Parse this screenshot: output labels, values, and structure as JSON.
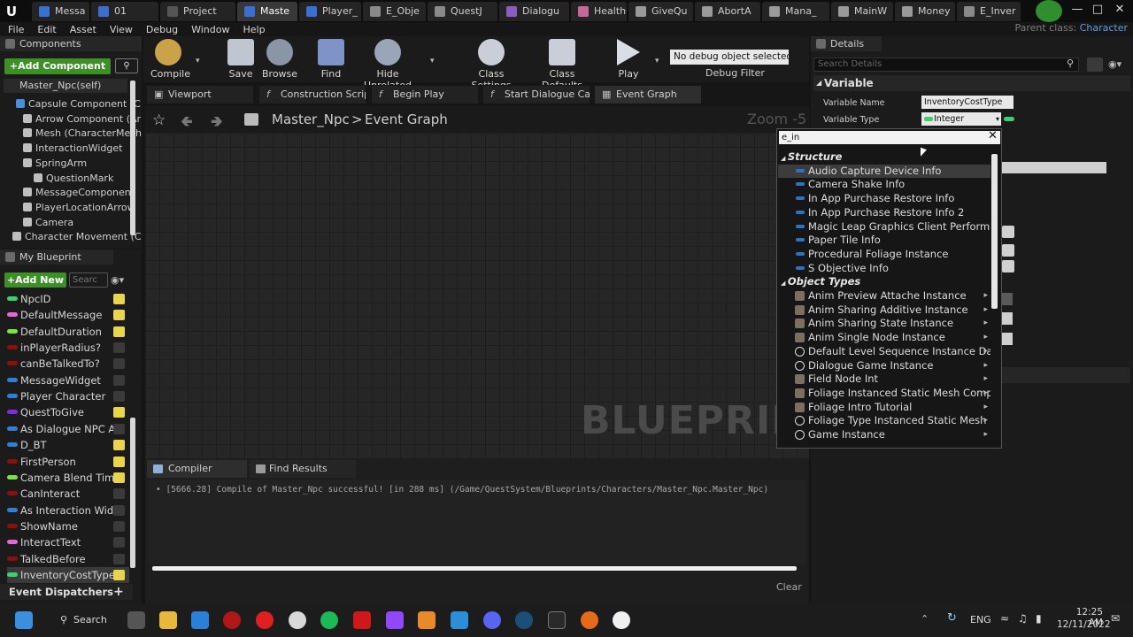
{
  "window_tabs": [
    {
      "label": "Messa",
      "color": "#3b6fd1"
    },
    {
      "label": "01",
      "color": "#3b6fd1"
    },
    {
      "label": "Project",
      "color": "#555555"
    },
    {
      "label": "Maste",
      "color": "#3b6fd1"
    },
    {
      "label": "Player_",
      "color": "#3b6fd1"
    },
    {
      "label": "E_Obje",
      "color": "#8a8a8a"
    },
    {
      "label": "QuestJ",
      "color": "#8a8a8a"
    },
    {
      "label": "Dialogu",
      "color": "#8a5cc4"
    },
    {
      "label": "HealthC",
      "color": "#c46a9a"
    },
    {
      "label": "GiveQu",
      "color": "#9a9a9a"
    },
    {
      "label": "AbortA",
      "color": "#9a9a9a"
    },
    {
      "label": "Mana_",
      "color": "#9a9a9a"
    },
    {
      "label": "MainW",
      "color": "#9a9a9a"
    },
    {
      "label": "Money",
      "color": "#9a9a9a"
    },
    {
      "label": "E_Inver",
      "color": "#8a8a8a"
    }
  ],
  "menu": [
    "File",
    "Edit",
    "Asset",
    "View",
    "Debug",
    "Window",
    "Help"
  ],
  "parent_class_label": "Parent class:",
  "parent_class_value": "Character",
  "components": {
    "title": "Components",
    "add_button": "+Add Component",
    "root": "Master_Npc(self)",
    "items": [
      {
        "label": "Capsule Component (C",
        "indent": 0,
        "color": "#4a8fd8"
      },
      {
        "label": "Arrow Component (Ar",
        "indent": 1,
        "color": "#bfbfbf"
      },
      {
        "label": "Mesh (CharacterMesh",
        "indent": 1,
        "color": "#bfbfbf"
      },
      {
        "label": "InteractionWidget",
        "indent": 1,
        "color": "#bfbfbf"
      },
      {
        "label": "SpringArm",
        "indent": 1,
        "color": "#bfbfbf"
      },
      {
        "label": "QuestionMark",
        "indent": 2,
        "color": "#bfbfbf"
      },
      {
        "label": "MessageComponent",
        "indent": 1,
        "color": "#bfbfbf"
      },
      {
        "label": "PlayerLocationArrow",
        "indent": 1,
        "color": "#bfbfbf"
      },
      {
        "label": "Camera",
        "indent": 1,
        "color": "#bfbfbf"
      },
      {
        "label": "Character Movement (C",
        "indent": 0,
        "color": "#bfbfbf"
      }
    ]
  },
  "my_blueprint": {
    "title": "My Blueprint",
    "add_button": "+Add New",
    "search_placeholder": "Searc",
    "variables": [
      {
        "name": "NpcID",
        "color": "#3fcf6f",
        "eye": true
      },
      {
        "name": "DefaultMessage",
        "color": "#e06ad8",
        "eye": true
      },
      {
        "name": "DefaultDuration",
        "color": "#7de04a",
        "eye": true
      },
      {
        "name": "inPlayerRadius?",
        "color": "#8a0f0f",
        "eye": false
      },
      {
        "name": "canBeTalkedTo?",
        "color": "#8a0f0f",
        "eye": false
      },
      {
        "name": "MessageWidget",
        "color": "#2f7fd8",
        "eye": false
      },
      {
        "name": "Player Character",
        "color": "#2f7fd8",
        "eye": false
      },
      {
        "name": "QuestToGive",
        "color": "#7b2fd8",
        "eye": true
      },
      {
        "name": "As Dialogue NPC A",
        "color": "#2f7fd8",
        "eye": false
      },
      {
        "name": "D_BT",
        "color": "#2f7fd8",
        "eye": true
      },
      {
        "name": "FirstPerson",
        "color": "#8a0f0f",
        "eye": true
      },
      {
        "name": "Camera Blend Time",
        "color": "#7de04a",
        "eye": true
      },
      {
        "name": "CanInteract",
        "color": "#8a0f0f",
        "eye": false
      },
      {
        "name": "As Interaction Wid",
        "color": "#2f7fd8",
        "eye": false
      },
      {
        "name": "ShowName",
        "color": "#8a0f0f",
        "eye": false
      },
      {
        "name": "InteractText",
        "color": "#e06ad8",
        "eye": false
      },
      {
        "name": "TalkedBefore",
        "color": "#8a0f0f",
        "eye": false
      },
      {
        "name": "InventoryCostType",
        "color": "#3fcf6f",
        "eye": true
      }
    ],
    "event_dispatchers": "Event Dispatchers"
  },
  "toolbar": {
    "buttons": [
      "Compile",
      "Save",
      "Browse",
      "Find",
      "Hide Unrelated",
      "Class Settings",
      "Class Defaults",
      "Play"
    ],
    "debug_select": "No debug object selected",
    "debug_filter": "Debug Filter"
  },
  "editor_tabs": [
    "Viewport",
    "Construction Scrip",
    "Begin Play",
    "Start Dialogue Car",
    "Event Graph"
  ],
  "graph": {
    "breadcrumb_root": "Master_Npc",
    "breadcrumb_sep": ">",
    "breadcrumb_leaf": "Event Graph",
    "zoom": "Zoom -5",
    "watermark": "BLUEPRIN"
  },
  "search_popup": {
    "query": "e_in",
    "category_structure": "Structure",
    "structure_items": [
      "Audio Capture Device Info",
      "Camera Shake Info",
      "In App Purchase Restore Info",
      "In App Purchase Restore Info 2",
      "Magic Leap Graphics Client Performan",
      "Paper Tile Info",
      "Procedural Foliage Instance",
      "S Objective Info"
    ],
    "category_object": "Object Types",
    "object_items": [
      {
        "label": "Anim Preview Attache Instance",
        "icon": "box",
        "arrow": true
      },
      {
        "label": "Anim Sharing Additive Instance",
        "icon": "box",
        "arrow": true
      },
      {
        "label": "Anim Sharing State Instance",
        "icon": "box",
        "arrow": true
      },
      {
        "label": "Anim Single Node Instance",
        "icon": "box",
        "arrow": true
      },
      {
        "label": "Default Level Sequence Instance Data",
        "icon": "circle",
        "arrow": true
      },
      {
        "label": "Dialogue Game Instance",
        "icon": "circle",
        "arrow": true
      },
      {
        "label": "Field Node Int",
        "icon": "box",
        "arrow": true
      },
      {
        "label": "Foliage Instanced Static Mesh Compor",
        "icon": "box",
        "arrow": true
      },
      {
        "label": "Foliage Intro Tutorial",
        "icon": "box",
        "arrow": true
      },
      {
        "label": "Foliage Type Instanced Static Mesh",
        "icon": "circle",
        "arrow": true
      },
      {
        "label": "Game Instance",
        "icon": "circle",
        "arrow": true
      }
    ]
  },
  "details": {
    "title": "Details",
    "search_placeholder": "Search Details",
    "section": "Variable",
    "variable_name_label": "Variable Name",
    "variable_name_value": "InventoryCostType",
    "variable_type_label": "Variable Type",
    "variable_type_value": "Integer"
  },
  "bottom": {
    "tabs": [
      "Compiler Results",
      "Find Results"
    ],
    "log": "• [5666.28] Compile of Master_Npc successful! [in 288 ms] (/Game/QuestSystem/Blueprints/Characters/Master_Npc.Master_Npc)",
    "clear": "Clear"
  },
  "taskbar": {
    "search": "Search",
    "lang": "ENG",
    "time": "12:25 AM",
    "date": "12/11/2022"
  }
}
